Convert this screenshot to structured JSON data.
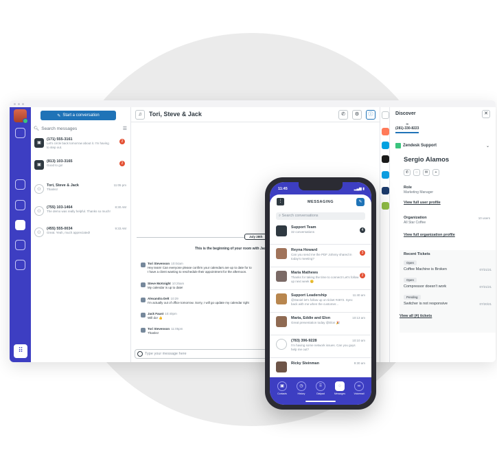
{
  "sidebar": {
    "dialpad_label": "⠿"
  },
  "list": {
    "start_label": "Start a conversation",
    "search_placeholder": "Search messages",
    "items": [
      {
        "title": "(171) 555-3161",
        "preview": "Let's circle back tomorrow about it. I'm having to step out.",
        "badge": "2",
        "time": ""
      },
      {
        "title": "(813) 103-3165",
        "preview": "Good to go!",
        "badge": "2",
        "time": ""
      },
      {
        "title": "Tori, Steve & Jack",
        "preview": "Thanks!",
        "badge": "",
        "time": "11:05 pm"
      },
      {
        "title": "(755) 103-1464",
        "preview": "The demo was really helpful. Thanks so much!",
        "badge": "",
        "time": "8:30 AM"
      },
      {
        "title": "(455) 555-0034",
        "preview": "Great. Yeah, much appreciated!",
        "badge": "",
        "time": "9:33 AM"
      }
    ]
  },
  "chat": {
    "title": "Tori, Steve & Jack",
    "date": "July 28th",
    "beginning": "This is the beginning of your room with Jack Fa",
    "messages": [
      {
        "name": "Tori Stevenson",
        "time": "10:04am",
        "lines": [
          "Hey team! Can everyone please confirm your calendars are up to date for to",
          "I have a client wanting to reschedule their appointment for the afternoon."
        ]
      },
      {
        "name": "Steve McKnight",
        "time": "10:25am",
        "lines": [
          "My calendar is up to date!"
        ]
      },
      {
        "name": "Alexandra Delt",
        "time": "10:29",
        "lines": [
          "I'm actually out of office tomorrow. Sorry, I will go update my calendar right"
        ]
      },
      {
        "name": "Jack Faust",
        "time": "10:40pm",
        "lines": [
          "Will do! 👍"
        ]
      },
      {
        "name": "Tori Stevenson",
        "time": "11:05pm",
        "lines": [
          "Thanks!"
        ]
      }
    ],
    "composer_placeholder": "Type your message here"
  },
  "panel": {
    "title": "Discover",
    "phone": "(281)-330-8223",
    "app_name": "Zendesk Support",
    "user_name": "Sergio Alamos",
    "role_label": "Role",
    "role_value": "Marketing Manager",
    "user_link": "View full user profile",
    "org_label": "Organization",
    "org_value": "All Star Coffee",
    "org_users": "10 users",
    "org_link": "View full organization profile",
    "tickets_label": "Recent Tickets",
    "tickets": [
      {
        "status": "Open",
        "title": "Coffee Machine is Broken",
        "date": "07/21/21"
      },
      {
        "status": "Open",
        "title": "Compressor doesn't work",
        "date": "07/21/21"
      },
      {
        "status": "Pending",
        "title": "Switcher is not responsive",
        "date": "07/20/21"
      }
    ],
    "tickets_link": "View all (#) tickets"
  },
  "phone": {
    "time": "11:45",
    "header": "MESSAGING",
    "search_placeholder": "Search conversations",
    "items": [
      {
        "title": "Support Team",
        "preview": "32 conversations",
        "time": "",
        "badge": "4",
        "dark": true
      },
      {
        "title": "Reyna Howard",
        "preview": "Can you send me the PDF Johnny shared in today's meeting?",
        "time": "",
        "badge": "3",
        "dark": false
      },
      {
        "title": "Maria Mathews",
        "preview": "Thanks for taking the time to connect! Let's follow up next week 😊",
        "time": "",
        "badge": "2",
        "dark": false
      },
      {
        "title": "Support Leadership",
        "preview": "@Daniel let's follow up on ticket #4872. Sync back with me when the customer...",
        "time": "11:40 am",
        "badge": "",
        "dark": false
      },
      {
        "title": "Maria, Eddie and Elon",
        "preview": "Great presentation today @Elon 🎉",
        "time": "10:13 am",
        "badge": "",
        "dark": false
      },
      {
        "title": "(783) 396-9228",
        "preview": "I'm having some network issues. Can you guys help me out?",
        "time": "10:10 am",
        "badge": "",
        "dark": false
      },
      {
        "title": "Ricky Steinman",
        "preview": "",
        "time": "9:30 am",
        "badge": "",
        "dark": false
      }
    ],
    "tabs": [
      "Contacts",
      "History",
      "Dialpad",
      "Messages",
      "Voicemail"
    ]
  },
  "colors": {
    "brand": "#3d3ec2",
    "accent": "#1f73b7",
    "badge": "#e34f32"
  }
}
